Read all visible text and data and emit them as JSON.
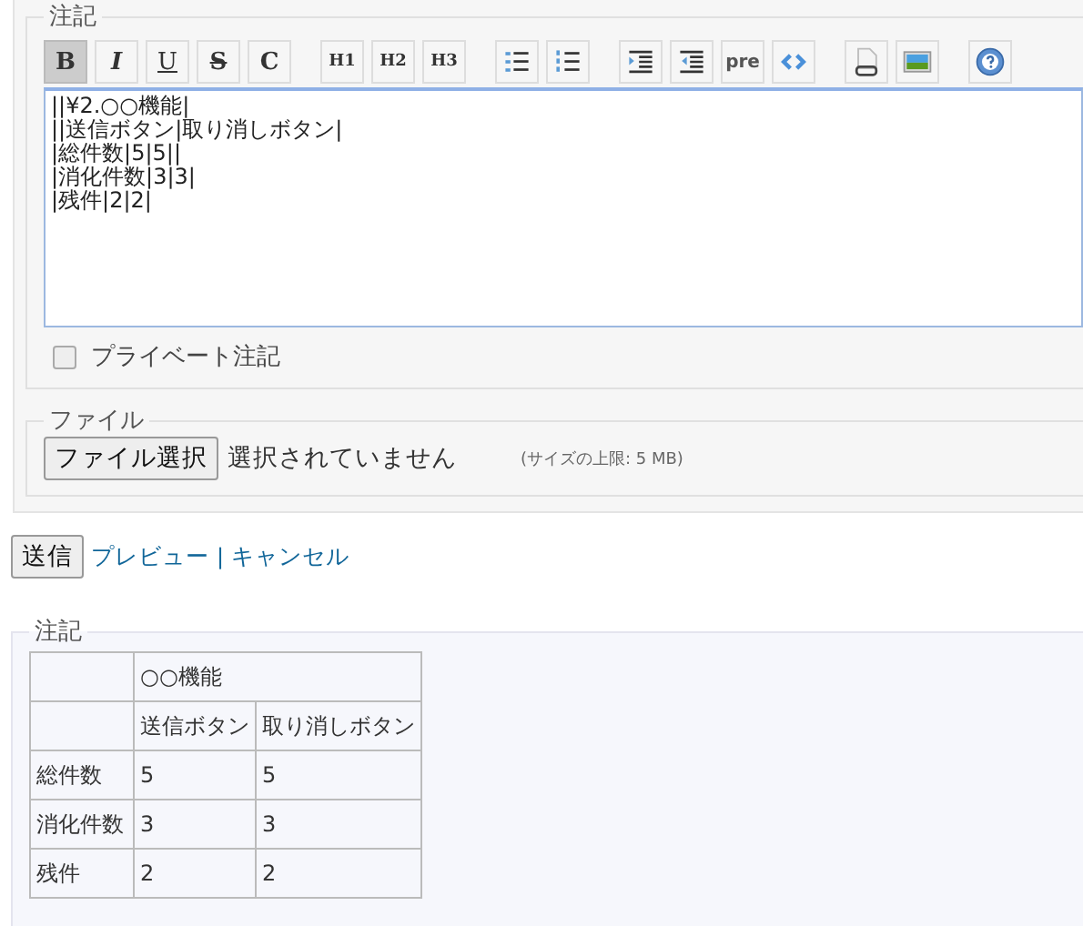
{
  "notes": {
    "legend": "注記",
    "toolbar": [
      {
        "kind": "text",
        "label": "B",
        "selected": true
      },
      {
        "kind": "text",
        "label": "I",
        "selected": false
      },
      {
        "kind": "text",
        "label": "U",
        "selected": false
      },
      {
        "kind": "text",
        "label": "S",
        "selected": false
      },
      {
        "kind": "text",
        "label": "C",
        "selected": false
      },
      {
        "kind": "gap"
      },
      {
        "kind": "text",
        "label": "H1",
        "selected": false
      },
      {
        "kind": "text",
        "label": "H2",
        "selected": false
      },
      {
        "kind": "text",
        "label": "H3",
        "selected": false
      },
      {
        "kind": "gap"
      },
      {
        "kind": "icon",
        "selected": false
      },
      {
        "kind": "icon",
        "selected": false
      },
      {
        "kind": "gap"
      },
      {
        "kind": "icon",
        "selected": false
      },
      {
        "kind": "icon",
        "selected": false
      },
      {
        "kind": "text",
        "label": "pre",
        "selected": false
      },
      {
        "kind": "icon",
        "selected": false
      },
      {
        "kind": "gap"
      },
      {
        "kind": "icon",
        "selected": false
      },
      {
        "kind": "icon",
        "selected": false
      },
      {
        "kind": "gap"
      },
      {
        "kind": "icon",
        "selected": false
      }
    ],
    "text_lines": [
      "||¥2.○○機能|",
      "||送信ボタン|取り消しボタン|",
      "|総件数|5|5||",
      "|消化件数|3|3|",
      "|残件|2|2|"
    ],
    "private": {
      "label": "プライベート注記",
      "checked": false
    }
  },
  "files": {
    "legend": "ファイル",
    "button": "ファイル選択",
    "status": "選択されていません",
    "limit": "(サイズの上限: 5 MB)"
  },
  "actions": {
    "submit": "送信",
    "preview": "プレビュー",
    "separator": "|",
    "cancel": "キャンセル"
  },
  "preview": {
    "legend": "注記",
    "table": {
      "group_heading": "○○機能",
      "columns": [
        "送信ボタン",
        "取り消しボタン"
      ],
      "rows": [
        {
          "label": "総件数",
          "cells": [
            "5",
            "5"
          ]
        },
        {
          "label": "消化件数",
          "cells": [
            "3",
            "3"
          ]
        },
        {
          "label": "残件",
          "cells": [
            "2",
            "2"
          ]
        }
      ]
    }
  }
}
